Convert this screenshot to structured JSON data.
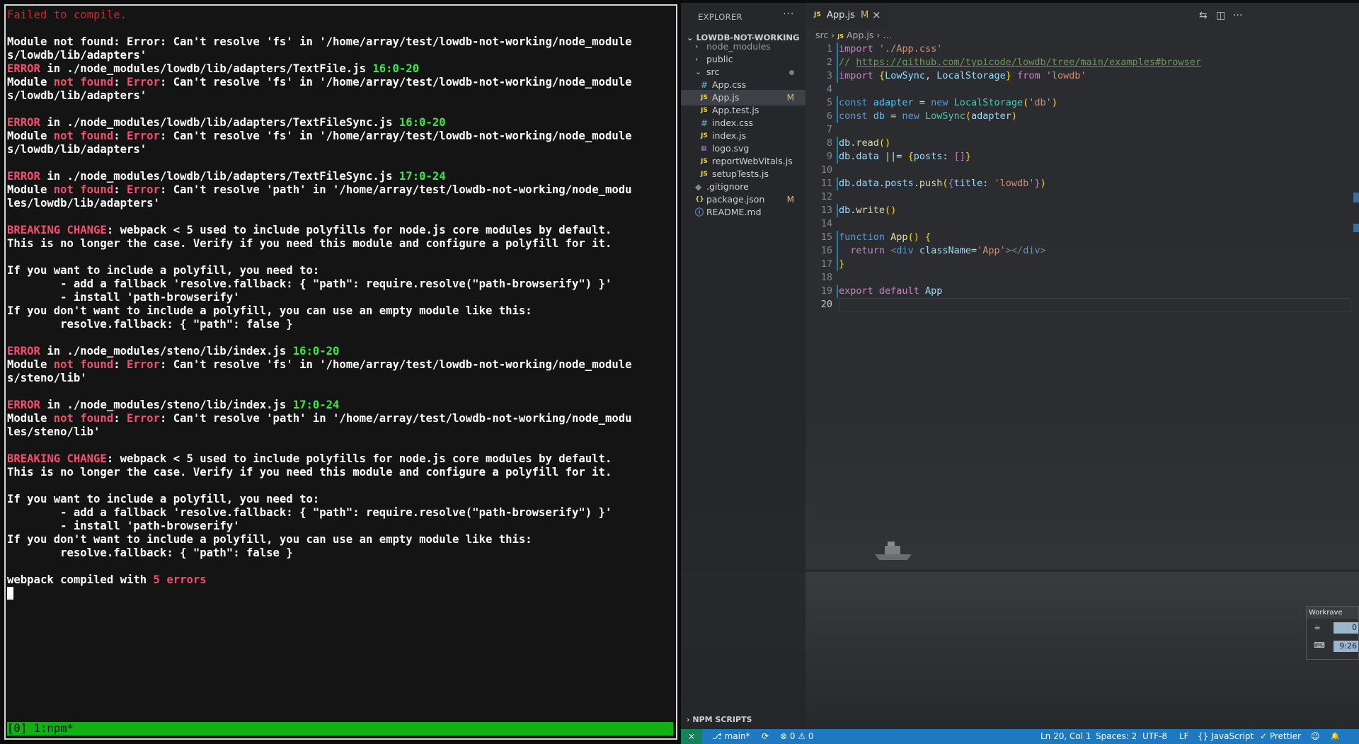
{
  "terminal": {
    "lines": [
      [
        {
          "t": "Failed to compile.",
          "c": "dimred"
        }
      ],
      [],
      [
        {
          "t": "Module not found: Error: Can't resolve 'fs' in '/home/array/test/lowdb-not-working/node_module",
          "c": "white"
        }
      ],
      [
        {
          "t": "s/lowdb/lib/adapters'",
          "c": "white"
        }
      ],
      [
        {
          "t": "ERROR",
          "c": "red"
        },
        {
          "t": " in ./node_modules/lowdb/lib/adapters/TextFile.js ",
          "c": "white"
        },
        {
          "t": "16:0-20",
          "c": "green"
        }
      ],
      [
        {
          "t": "Module ",
          "c": "white"
        },
        {
          "t": "not found",
          "c": "red"
        },
        {
          "t": ": ",
          "c": "white"
        },
        {
          "t": "Error",
          "c": "red"
        },
        {
          "t": ": Can't resolve 'fs' in '/home/array/test/lowdb-not-working/node_module",
          "c": "white"
        }
      ],
      [
        {
          "t": "s/lowdb/lib/adapters'",
          "c": "white"
        }
      ],
      [],
      [
        {
          "t": "ERROR",
          "c": "red"
        },
        {
          "t": " in ./node_modules/lowdb/lib/adapters/TextFileSync.js ",
          "c": "white"
        },
        {
          "t": "16:0-20",
          "c": "green"
        }
      ],
      [
        {
          "t": "Module ",
          "c": "white"
        },
        {
          "t": "not found",
          "c": "red"
        },
        {
          "t": ": ",
          "c": "white"
        },
        {
          "t": "Error",
          "c": "red"
        },
        {
          "t": ": Can't resolve 'fs' in '/home/array/test/lowdb-not-working/node_module",
          "c": "white"
        }
      ],
      [
        {
          "t": "s/lowdb/lib/adapters'",
          "c": "white"
        }
      ],
      [],
      [
        {
          "t": "ERROR",
          "c": "red"
        },
        {
          "t": " in ./node_modules/lowdb/lib/adapters/TextFileSync.js ",
          "c": "white"
        },
        {
          "t": "17:0-24",
          "c": "green"
        }
      ],
      [
        {
          "t": "Module ",
          "c": "white"
        },
        {
          "t": "not found",
          "c": "red"
        },
        {
          "t": ": ",
          "c": "white"
        },
        {
          "t": "Error",
          "c": "red"
        },
        {
          "t": ": Can't resolve 'path' in '/home/array/test/lowdb-not-working/node_modu",
          "c": "white"
        }
      ],
      [
        {
          "t": "les/lowdb/lib/adapters'",
          "c": "white"
        }
      ],
      [],
      [
        {
          "t": "BREAKING CHANGE",
          "c": "red"
        },
        {
          "t": ": webpack < 5 used to include polyfills for node.js core modules by default.",
          "c": "white"
        }
      ],
      [
        {
          "t": "This is no longer the case. Verify if you need this module and configure a polyfill for it.",
          "c": "white"
        }
      ],
      [],
      [
        {
          "t": "If you want to include a polyfill, you need to:",
          "c": "white"
        }
      ],
      [
        {
          "t": "        - add a fallback 'resolve.fallback: { \"path\": require.resolve(\"path-browserify\") }'",
          "c": "white"
        }
      ],
      [
        {
          "t": "        - install 'path-browserify'",
          "c": "white"
        }
      ],
      [
        {
          "t": "If you don't want to include a polyfill, you can use an empty module like this:",
          "c": "white"
        }
      ],
      [
        {
          "t": "        resolve.fallback: { \"path\": false }",
          "c": "white"
        }
      ],
      [],
      [
        {
          "t": "ERROR",
          "c": "red"
        },
        {
          "t": " in ./node_modules/steno/lib/index.js ",
          "c": "white"
        },
        {
          "t": "16:0-20",
          "c": "green"
        }
      ],
      [
        {
          "t": "Module ",
          "c": "white"
        },
        {
          "t": "not found",
          "c": "red"
        },
        {
          "t": ": ",
          "c": "white"
        },
        {
          "t": "Error",
          "c": "red"
        },
        {
          "t": ": Can't resolve 'fs' in '/home/array/test/lowdb-not-working/node_module",
          "c": "white"
        }
      ],
      [
        {
          "t": "s/steno/lib'",
          "c": "white"
        }
      ],
      [],
      [
        {
          "t": "ERROR",
          "c": "red"
        },
        {
          "t": " in ./node_modules/steno/lib/index.js ",
          "c": "white"
        },
        {
          "t": "17:0-24",
          "c": "green"
        }
      ],
      [
        {
          "t": "Module ",
          "c": "white"
        },
        {
          "t": "not found",
          "c": "red"
        },
        {
          "t": ": ",
          "c": "white"
        },
        {
          "t": "Error",
          "c": "red"
        },
        {
          "t": ": Can't resolve 'path' in '/home/array/test/lowdb-not-working/node_modu",
          "c": "white"
        }
      ],
      [
        {
          "t": "les/steno/lib'",
          "c": "white"
        }
      ],
      [],
      [
        {
          "t": "BREAKING CHANGE",
          "c": "red"
        },
        {
          "t": ": webpack < 5 used to include polyfills for node.js core modules by default.",
          "c": "white"
        }
      ],
      [
        {
          "t": "This is no longer the case. Verify if you need this module and configure a polyfill for it.",
          "c": "white"
        }
      ],
      [],
      [
        {
          "t": "If you want to include a polyfill, you need to:",
          "c": "white"
        }
      ],
      [
        {
          "t": "        - add a fallback 'resolve.fallback: { \"path\": require.resolve(\"path-browserify\") }'",
          "c": "white"
        }
      ],
      [
        {
          "t": "        - install 'path-browserify'",
          "c": "white"
        }
      ],
      [
        {
          "t": "If you don't want to include a polyfill, you can use an empty module like this:",
          "c": "white"
        }
      ],
      [
        {
          "t": "        resolve.fallback: { \"path\": false }",
          "c": "white"
        }
      ],
      [],
      [
        {
          "t": "webpack compiled with ",
          "c": "white"
        },
        {
          "t": "5 errors",
          "c": "red"
        }
      ]
    ],
    "status_bar": "[0] 1:npm*"
  },
  "explorer": {
    "title": "EXPLORER",
    "more": "···",
    "root_folder": "LOWDB-NOT-WORKING",
    "items": [
      {
        "name": "node_modules",
        "kind": "folder",
        "expanded": false,
        "indent": 0,
        "dim": true
      },
      {
        "name": "public",
        "kind": "folder",
        "expanded": false,
        "indent": 0
      },
      {
        "name": "src",
        "kind": "folder",
        "expanded": true,
        "indent": 0,
        "dot": true
      },
      {
        "name": "App.css",
        "kind": "css",
        "indent": 1
      },
      {
        "name": "App.js",
        "kind": "js",
        "indent": 1,
        "badge": "M",
        "active": true
      },
      {
        "name": "App.test.js",
        "kind": "js",
        "indent": 1
      },
      {
        "name": "index.css",
        "kind": "css",
        "indent": 1
      },
      {
        "name": "index.js",
        "kind": "js",
        "indent": 1
      },
      {
        "name": "logo.svg",
        "kind": "svg",
        "indent": 1
      },
      {
        "name": "reportWebVitals.js",
        "kind": "js",
        "indent": 1
      },
      {
        "name": "setupTests.js",
        "kind": "js",
        "indent": 1
      },
      {
        "name": ".gitignore",
        "kind": "git",
        "indent": 0
      },
      {
        "name": "package.json",
        "kind": "json",
        "indent": 0,
        "badge": "M"
      },
      {
        "name": "README.md",
        "kind": "info",
        "indent": 0
      }
    ],
    "npm_scripts": "NPM SCRIPTS",
    "icon_glyphs": {
      "js": "JS",
      "css": "#",
      "svg": "▦",
      "json": "{}",
      "info": "ⓘ",
      "git": "◆"
    }
  },
  "tab": {
    "icon": "JS",
    "label": "App.js",
    "modified": "M",
    "close": "×"
  },
  "breadcrumb": {
    "folder": "src",
    "sep": "›",
    "icon": "JS",
    "file": "App.js",
    "more": "…"
  },
  "code": {
    "current_line": 20,
    "lines": [
      [
        {
          "t": "import",
          "c": "kw"
        },
        {
          "t": " ",
          "c": "op"
        },
        {
          "t": "'./App.css'",
          "c": "str"
        }
      ],
      [
        {
          "t": "// ",
          "c": "com"
        },
        {
          "t": "https://github.com/typicode/lowdb/tree/main/examples#browser",
          "c": "link"
        }
      ],
      [
        {
          "t": "import",
          "c": "kw"
        },
        {
          "t": " ",
          "c": "op"
        },
        {
          "t": "{",
          "c": "brk"
        },
        {
          "t": "LowSync",
          "c": "var"
        },
        {
          "t": ", ",
          "c": "op"
        },
        {
          "t": "LocalStorage",
          "c": "var"
        },
        {
          "t": "}",
          "c": "brk"
        },
        {
          "t": " ",
          "c": "op"
        },
        {
          "t": "from",
          "c": "kw"
        },
        {
          "t": " ",
          "c": "op"
        },
        {
          "t": "'lowdb'",
          "c": "str"
        }
      ],
      [],
      [
        {
          "t": "const",
          "c": "kw2"
        },
        {
          "t": " ",
          "c": "op"
        },
        {
          "t": "adapter",
          "c": "const"
        },
        {
          "t": " = ",
          "c": "op"
        },
        {
          "t": "new",
          "c": "kw2"
        },
        {
          "t": " ",
          "c": "op"
        },
        {
          "t": "LocalStorage",
          "c": "cls"
        },
        {
          "t": "(",
          "c": "brk"
        },
        {
          "t": "'db'",
          "c": "str"
        },
        {
          "t": ")",
          "c": "brk"
        }
      ],
      [
        {
          "t": "const",
          "c": "kw2"
        },
        {
          "t": " ",
          "c": "op"
        },
        {
          "t": "db",
          "c": "const"
        },
        {
          "t": " = ",
          "c": "op"
        },
        {
          "t": "new",
          "c": "kw2"
        },
        {
          "t": " ",
          "c": "op"
        },
        {
          "t": "LowSync",
          "c": "cls"
        },
        {
          "t": "(",
          "c": "brk"
        },
        {
          "t": "adapter",
          "c": "var"
        },
        {
          "t": ")",
          "c": "brk"
        }
      ],
      [],
      [
        {
          "t": "db",
          "c": "var"
        },
        {
          "t": ".",
          "c": "op"
        },
        {
          "t": "read",
          "c": "fn"
        },
        {
          "t": "()",
          "c": "brk"
        }
      ],
      [
        {
          "t": "db",
          "c": "var"
        },
        {
          "t": ".",
          "c": "op"
        },
        {
          "t": "data",
          "c": "var"
        },
        {
          "t": " ||= ",
          "c": "op"
        },
        {
          "t": "{",
          "c": "brk"
        },
        {
          "t": "posts",
          "c": "var"
        },
        {
          "t": ": ",
          "c": "op"
        },
        {
          "t": "[]",
          "c": "brk2"
        },
        {
          "t": "}",
          "c": "brk"
        }
      ],
      [],
      [
        {
          "t": "db",
          "c": "var"
        },
        {
          "t": ".",
          "c": "op"
        },
        {
          "t": "data",
          "c": "var"
        },
        {
          "t": ".",
          "c": "op"
        },
        {
          "t": "posts",
          "c": "var"
        },
        {
          "t": ".",
          "c": "op"
        },
        {
          "t": "push",
          "c": "fn"
        },
        {
          "t": "(",
          "c": "brk"
        },
        {
          "t": "{",
          "c": "brk2"
        },
        {
          "t": "title",
          "c": "var"
        },
        {
          "t": ": ",
          "c": "op"
        },
        {
          "t": "'lowdb'",
          "c": "str"
        },
        {
          "t": "}",
          "c": "brk2"
        },
        {
          "t": ")",
          "c": "brk"
        }
      ],
      [],
      [
        {
          "t": "db",
          "c": "var"
        },
        {
          "t": ".",
          "c": "op"
        },
        {
          "t": "write",
          "c": "fn"
        },
        {
          "t": "()",
          "c": "brk"
        }
      ],
      [],
      [
        {
          "t": "function",
          "c": "kw2"
        },
        {
          "t": " ",
          "c": "op"
        },
        {
          "t": "App",
          "c": "fn"
        },
        {
          "t": "() ",
          "c": "brk"
        },
        {
          "t": "{",
          "c": "brk"
        }
      ],
      [
        {
          "t": "  ",
          "c": "op"
        },
        {
          "t": "return",
          "c": "kw"
        },
        {
          "t": " ",
          "c": "op"
        },
        {
          "t": "<",
          "c": "tag"
        },
        {
          "t": "div",
          "c": "kw2"
        },
        {
          "t": " ",
          "c": "op"
        },
        {
          "t": "className",
          "c": "attr"
        },
        {
          "t": "=",
          "c": "op"
        },
        {
          "t": "'App'",
          "c": "str"
        },
        {
          "t": "></",
          "c": "tag"
        },
        {
          "t": "div",
          "c": "kw2"
        },
        {
          "t": ">",
          "c": "tag"
        }
      ],
      [
        {
          "t": "}",
          "c": "brk"
        }
      ],
      [],
      [
        {
          "t": "export",
          "c": "kw"
        },
        {
          "t": " ",
          "c": "op"
        },
        {
          "t": "default",
          "c": "kw"
        },
        {
          "t": " ",
          "c": "op"
        },
        {
          "t": "App",
          "c": "var"
        }
      ],
      []
    ],
    "colors": {
      "kw": "#c586c0",
      "kw2": "#569cd6",
      "str": "#ce9178",
      "com": "#6a9955",
      "link": "#6a9955",
      "var": "#9cdcfe",
      "fn": "#dcdcaa",
      "cls": "#4ec9b0",
      "brk": "#ffd700",
      "brk2": "#da70d6",
      "tag": "#808080",
      "attr": "#9cdcfe",
      "const": "#4fc1ff",
      "op": "#d4d4d4"
    }
  },
  "statusbar": {
    "remote": "⨯",
    "branch": "main*",
    "sync": "⟳",
    "errors": "⊗ 0",
    "warnings": "⚠ 0",
    "position": "Ln 20, Col 1",
    "spaces": "Spaces: 2",
    "encoding": "UTF-8",
    "eol": "LF",
    "language": "JavaScript",
    "formatter": "✓ Prettier",
    "feedback": "☺",
    "bell": "🔔"
  },
  "workrave": {
    "title": "Workrave",
    "rows": [
      {
        "icon": "☕",
        "value": "0"
      },
      {
        "icon": "⌨",
        "value": "9:26"
      }
    ]
  },
  "colors": {
    "accent": "#1f79c0",
    "terminal_bar": "#12b012",
    "error_red": "#f0506e",
    "ok_green": "#3ae84b"
  }
}
